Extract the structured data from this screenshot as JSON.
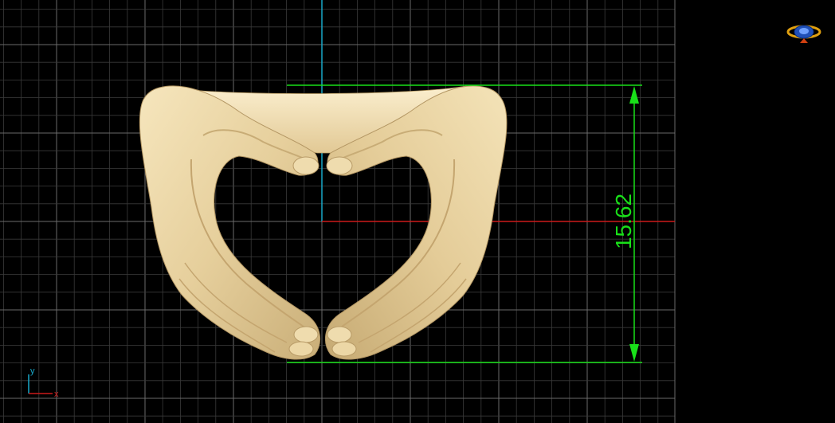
{
  "viewport": {
    "background": "#000000",
    "grid_minor_color": "#3a3a3a",
    "grid_major_color": "#6a6a6a",
    "axis_x_color": "#cc1a1a",
    "axis_y_color": "#18a8c8",
    "dimension_color": "#19e019",
    "model_color": "#e9d4a4"
  },
  "dimension": {
    "value": "15.62"
  },
  "triad": {
    "x_label": "x",
    "y_label": "y"
  },
  "navigation": {
    "icon": "view-cube-icon"
  }
}
